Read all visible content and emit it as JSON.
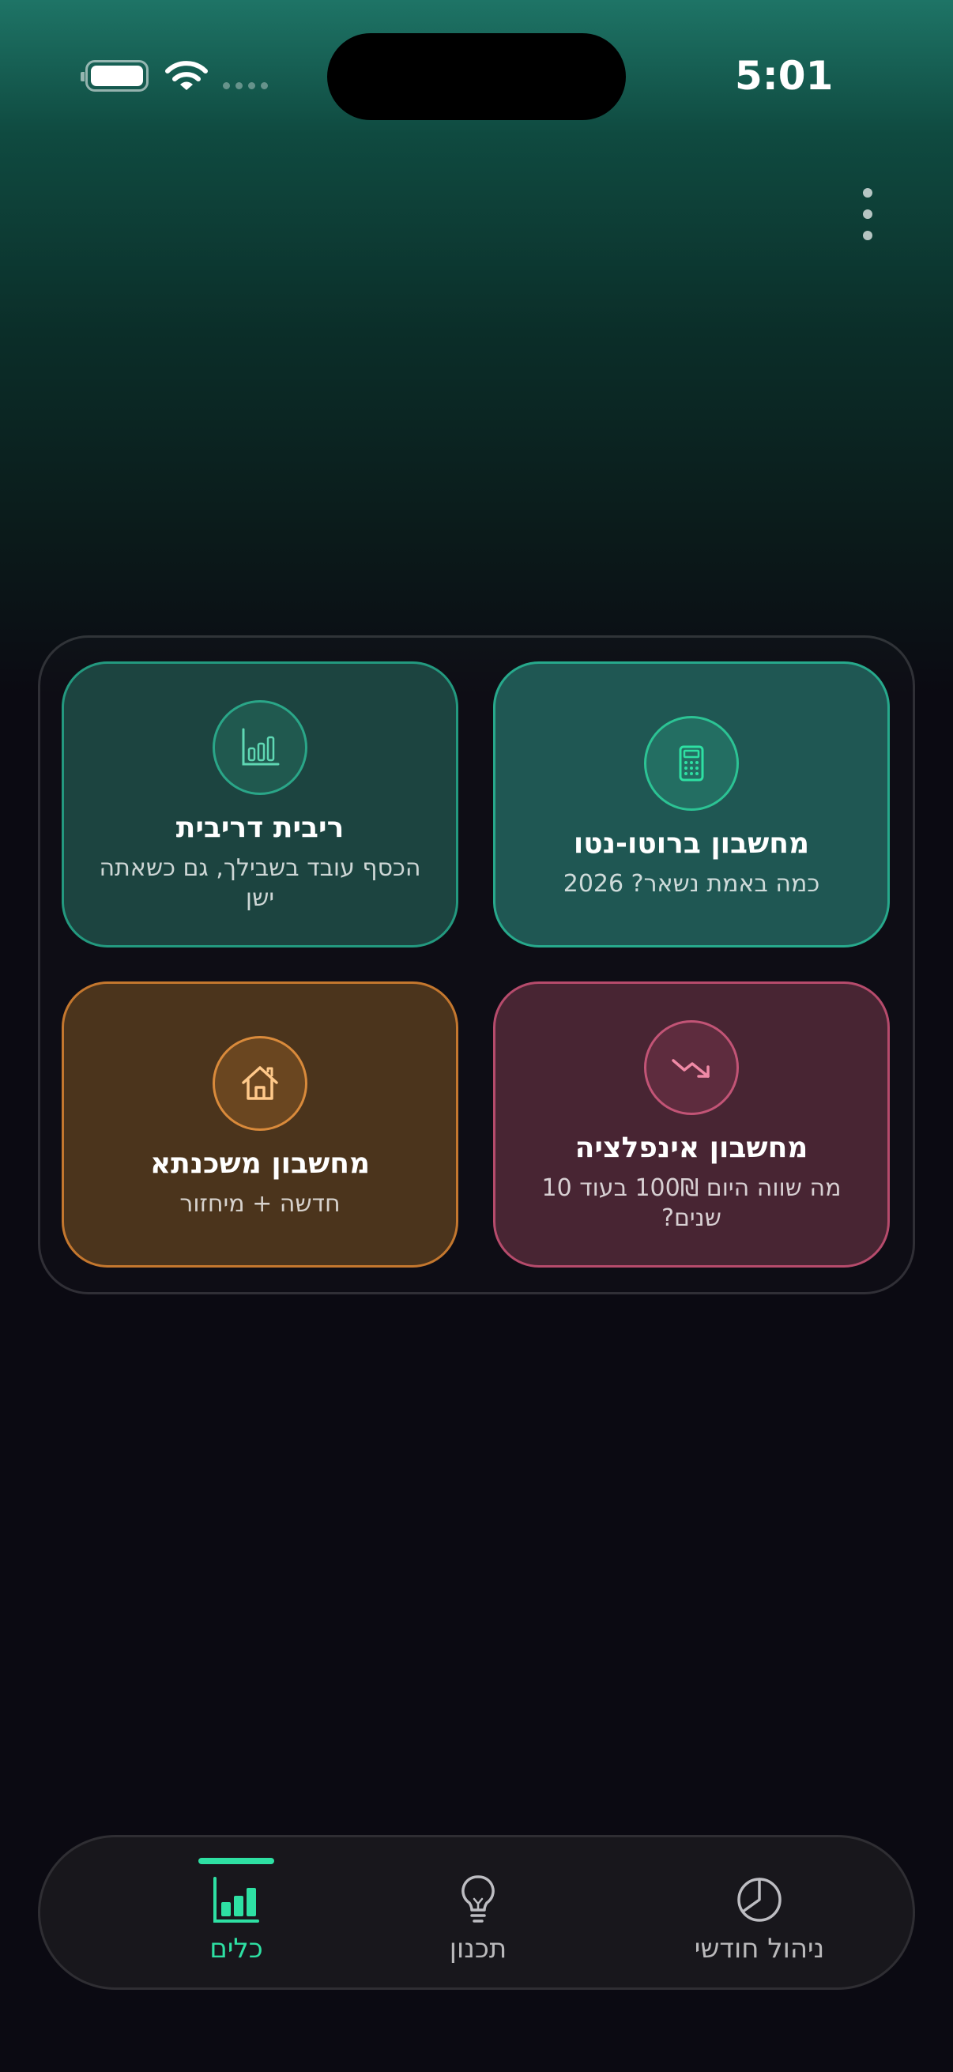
{
  "status_bar": {
    "time": "5:01",
    "battery_icon": "battery-full-icon",
    "wifi_icon": "wifi-icon",
    "signal_icon": "signal-dots-icon"
  },
  "header": {
    "menu_icon": "kebab-menu-icon"
  },
  "tools": [
    {
      "id": "net-calculator",
      "title": "מחשבון ברוטו-נטו",
      "subtitle": "כמה באמת נשאר? 2026",
      "icon": "calculator-icon",
      "accent": "#2cc394"
    },
    {
      "id": "compound-interest",
      "title": "ריבית דריבית",
      "subtitle": "הכסף עובד בשבילך, גם כשאתה ישן",
      "icon": "bar-chart-icon",
      "accent": "#2aa688"
    },
    {
      "id": "inflation-calculator",
      "title": "מחשבון אינפלציה",
      "subtitle": "מה שווה היום 100₪ בעוד 10 שנים?",
      "icon": "trend-down-icon",
      "accent": "#c25476"
    },
    {
      "id": "mortgage-calculator",
      "title": "מחשבון משכנתא",
      "subtitle": "חדשה + מיחזור",
      "icon": "house-icon",
      "accent": "#d98a3b"
    }
  ],
  "bottom_nav": {
    "active_color": "#2ee0a3",
    "items": [
      {
        "label": "כלים",
        "icon": "bar-chart-icon",
        "active": true
      },
      {
        "label": "תכנון",
        "icon": "lightbulb-icon",
        "active": false
      },
      {
        "label": "ניהול חודשי",
        "icon": "pie-chart-icon",
        "active": false
      }
    ]
  }
}
